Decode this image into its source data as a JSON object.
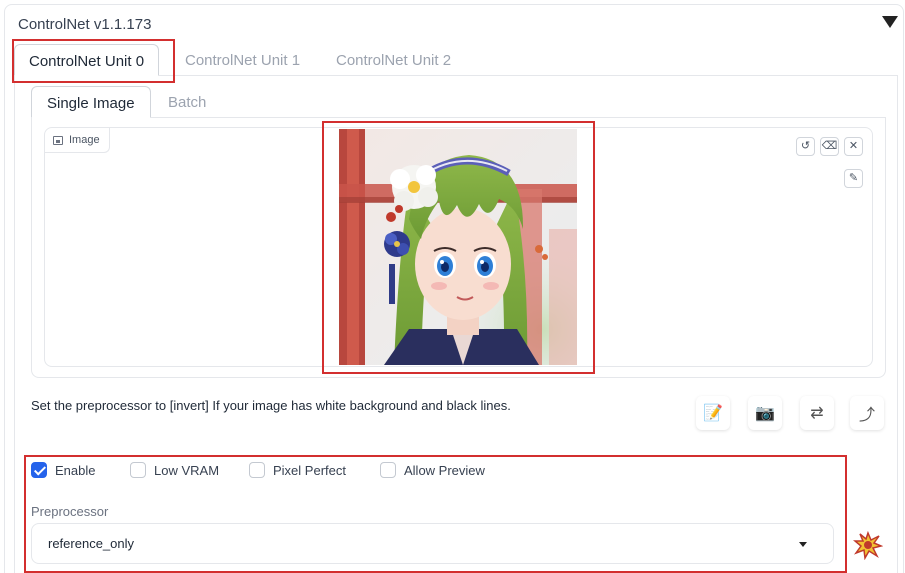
{
  "panel": {
    "title": "ControlNet v1.1.173"
  },
  "unit_tabs": [
    "ControlNet Unit 0",
    "ControlNet Unit 1",
    "ControlNet Unit 2"
  ],
  "sub_tabs": [
    "Single Image",
    "Batch"
  ],
  "image": {
    "label": "Image",
    "tools": {
      "undo": "↺",
      "clear": "⌫",
      "close": "✕",
      "edit": "✎"
    }
  },
  "hint": "Set the preprocessor to [invert] If your image has white background and black lines.",
  "actions": {
    "notes": "📝",
    "camera": "📷",
    "swap": "⇄",
    "send": "⤴"
  },
  "options": {
    "enable": {
      "label": "Enable",
      "checked": true
    },
    "low_vram": {
      "label": "Low VRAM",
      "checked": false
    },
    "pixel_perfect": {
      "label": "Pixel Perfect",
      "checked": false
    },
    "allow_preview": {
      "label": "Allow Preview",
      "checked": false
    }
  },
  "preprocessor": {
    "label": "Preprocessor",
    "value": "reference_only"
  },
  "colors": {
    "accent": "#2563eb",
    "highlight": "#d32f2f"
  }
}
